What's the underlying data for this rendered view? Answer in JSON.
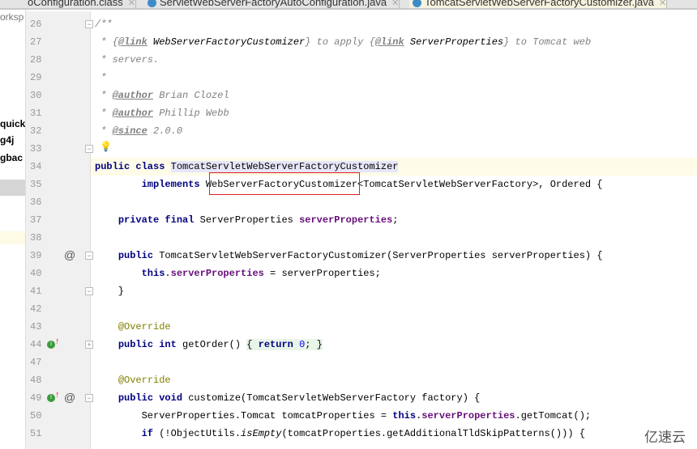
{
  "tabs": [
    {
      "label": "oConfiguration.class",
      "active": false
    },
    {
      "label": "ServletWebServerFactoryAutoConfiguration.java",
      "active": false
    },
    {
      "label": "TomcatServletWebServerFactoryCustomizer.java",
      "active": true
    }
  ],
  "project_panel": {
    "items": [
      "orksp",
      "quick",
      "g4j",
      "gbac"
    ]
  },
  "lines": [
    {
      "n": "26",
      "t": [
        [
          "/**",
          "cm"
        ]
      ],
      "fold": "-"
    },
    {
      "n": "27",
      "t": [
        [
          " * ",
          "cm"
        ],
        [
          "{",
          "cm"
        ],
        [
          "@link",
          "tag"
        ],
        [
          " ",
          "cm"
        ],
        [
          "WebServerFactoryCustomizer",
          "st"
        ],
        [
          "} to apply {",
          "cm"
        ],
        [
          "@link",
          "tag"
        ],
        [
          " ",
          "cm"
        ],
        [
          "ServerProperties",
          "st"
        ],
        [
          "} to Tomcat web",
          "cm"
        ]
      ]
    },
    {
      "n": "28",
      "t": [
        [
          " * servers.",
          "cm"
        ]
      ]
    },
    {
      "n": "29",
      "t": [
        [
          " *",
          "cm"
        ]
      ]
    },
    {
      "n": "30",
      "t": [
        [
          " * ",
          "cm"
        ],
        [
          "@author",
          "tag"
        ],
        [
          " Brian Clozel",
          "cm"
        ]
      ]
    },
    {
      "n": "31",
      "t": [
        [
          " * ",
          "cm"
        ],
        [
          "@author",
          "tag"
        ],
        [
          " Phillip Webb",
          "cm"
        ]
      ]
    },
    {
      "n": "32",
      "t": [
        [
          " * ",
          "cm"
        ],
        [
          "@since",
          "tag"
        ],
        [
          " 2.0.0",
          "cm"
        ]
      ]
    },
    {
      "n": "33",
      "t": [
        [
          " */",
          "cm"
        ]
      ],
      "fold": "-",
      "bulb": true
    },
    {
      "n": "34",
      "t": [
        [
          "public class ",
          "kw"
        ],
        [
          "TomcatServletWebServerFactoryCustomizer",
          "hl"
        ]
      ],
      "caret": true
    },
    {
      "n": "35",
      "t": [
        [
          "        ",
          ""
        ],
        [
          "implements ",
          "kw"
        ],
        [
          "WebServerFactoryCustomizer<TomcatServletWebServerFactory>, Ordered {",
          ""
        ]
      ]
    },
    {
      "n": "36",
      "t": []
    },
    {
      "n": "37",
      "t": [
        [
          "    ",
          ""
        ],
        [
          "private final ",
          "kw"
        ],
        [
          "ServerProperties ",
          ""
        ],
        [
          "serverProperties",
          "fld"
        ],
        [
          ";",
          ""
        ]
      ]
    },
    {
      "n": "38",
      "t": []
    },
    {
      "n": "39",
      "t": [
        [
          "    ",
          ""
        ],
        [
          "public ",
          "kw"
        ],
        [
          "TomcatServletWebServerFactoryCustomizer(ServerProperties serverProperties) {",
          ""
        ]
      ],
      "fold": "-",
      "at": true
    },
    {
      "n": "40",
      "t": [
        [
          "        ",
          ""
        ],
        [
          "this",
          "kw"
        ],
        [
          ".",
          ""
        ],
        [
          "serverProperties",
          "fld"
        ],
        [
          " = serverProperties;",
          ""
        ]
      ]
    },
    {
      "n": "41",
      "t": [
        [
          "    }",
          ""
        ]
      ],
      "fold": "-"
    },
    {
      "n": "42",
      "t": []
    },
    {
      "n": "43",
      "t": [
        [
          "    ",
          ""
        ],
        [
          "@Override",
          "ann"
        ]
      ]
    },
    {
      "n": "44",
      "t": [
        [
          "    ",
          ""
        ],
        [
          "public int ",
          "kw"
        ],
        [
          "getOrder() ",
          ""
        ],
        [
          "{ ",
          "br"
        ],
        [
          "return ",
          "kw br"
        ],
        [
          "0",
          "num br"
        ],
        [
          "; }",
          "br"
        ]
      ],
      "fold": "+",
      "impl": true
    },
    {
      "n": "47",
      "t": []
    },
    {
      "n": "48",
      "t": [
        [
          "    ",
          ""
        ],
        [
          "@Override",
          "ann"
        ]
      ]
    },
    {
      "n": "49",
      "t": [
        [
          "    ",
          ""
        ],
        [
          "public void ",
          "kw"
        ],
        [
          "customize(TomcatServletWebServerFactory factory) {",
          ""
        ]
      ],
      "fold": "-",
      "impl": true,
      "at": true
    },
    {
      "n": "50",
      "t": [
        [
          "        ServerProperties.Tomcat tomcatProperties = ",
          ""
        ],
        [
          "this",
          "kw"
        ],
        [
          ".",
          ""
        ],
        [
          "serverProperties",
          "fld"
        ],
        [
          ".getTomcat();",
          ""
        ]
      ]
    },
    {
      "n": "51",
      "t": [
        [
          "        ",
          ""
        ],
        [
          "if ",
          "kw"
        ],
        [
          "(!ObjectUtils.",
          ""
        ],
        [
          "isEmpty",
          "st"
        ],
        [
          "(tomcatProperties.getAdditionalTldSkipPatterns())) {",
          ""
        ]
      ]
    }
  ],
  "watermark": "亿速云",
  "colors": {
    "keyword": "#000080",
    "comment": "#808080",
    "field": "#660e7a",
    "annotation": "#808000",
    "highlight_box": "#e02020"
  }
}
